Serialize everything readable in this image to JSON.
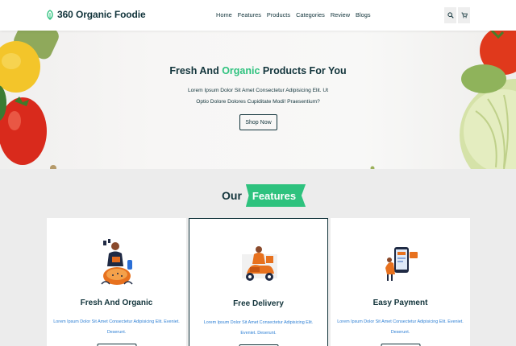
{
  "header": {
    "logo": "360 Organic Foodie",
    "nav": [
      "Home",
      "Features",
      "Products",
      "Categories",
      "Review",
      "Blogs"
    ],
    "search_icon": "search-icon",
    "cart_icon": "cart-icon"
  },
  "hero": {
    "title_start": "Fresh And ",
    "title_accent": "Organic",
    "title_end": " Products For You",
    "text": "Lorem Ipsum Dolor Sit Amet Consectetur Adipisicing Elit. Ut Optio Dolore Dolores Cupiditate Modi! Praesentium?",
    "button": "Shop Now"
  },
  "features": {
    "heading_our": "Our",
    "heading_accent": "Features",
    "cards": [
      {
        "title": "Fresh And Organic",
        "text": "Lorem Ipsum Dolor Sit Amet Consectetur Adipisicing Elit. Eveniet. Deserunt."
      },
      {
        "title": "Free Delivery",
        "text": "Lorem Ipsum Dolor Sit Amet Consectetur Adipisicing Elit. Eveniet. Deserunt."
      },
      {
        "title": "Easy Payment",
        "text": "Lorem Ipsum Dolor Sit Amet Consectetur Adipisicing Elit. Eveniet. Deserunt."
      }
    ]
  },
  "colors": {
    "accent": "#2ec27e",
    "dark": "#12343b",
    "link_text": "#2d7fd4"
  }
}
